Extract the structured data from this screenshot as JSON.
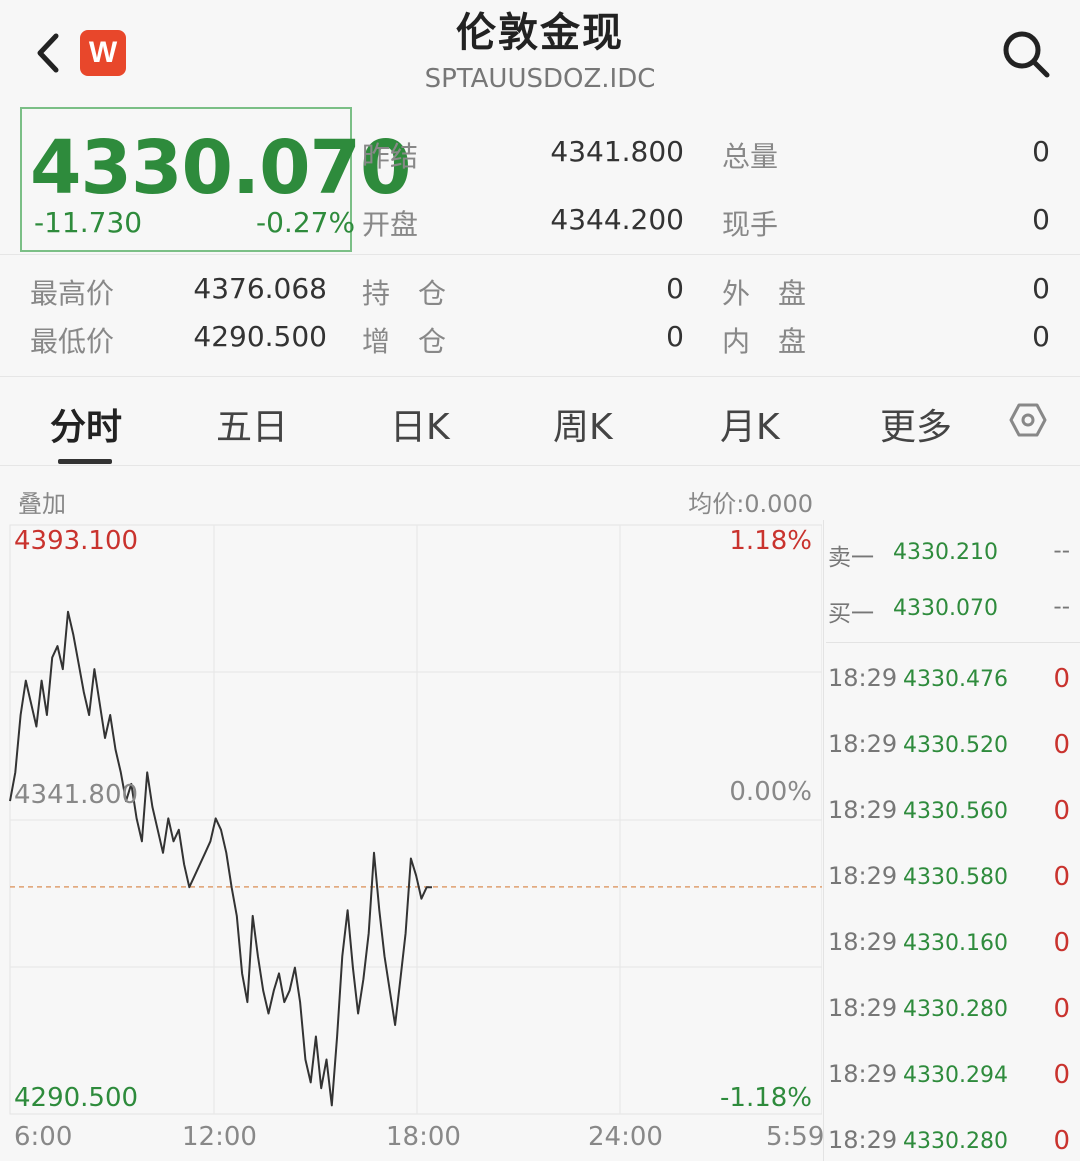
{
  "header": {
    "title": "伦敦金现",
    "code": "SPTAUUSDOZ.IDC",
    "logo": "W"
  },
  "quote": {
    "price": "4330.070",
    "change": "-11.730",
    "change_pct": "-0.27%",
    "prev_close_label": "昨结",
    "prev_close": "4341.800",
    "open_label": "开盘",
    "open": "4344.200",
    "volume_label": "总量",
    "volume": "0",
    "current_hand_label": "现手",
    "current_hand": "0",
    "high_label": "最高价",
    "high": "4376.068",
    "low_label": "最低价",
    "low": "4290.500",
    "position_label": "持　仓",
    "position": "0",
    "add_position_label": "增　仓",
    "add_position": "0",
    "outer_label": "外　盘",
    "outer": "0",
    "inner_label": "内　盘",
    "inner": "0"
  },
  "tabs": [
    {
      "label": "分时"
    },
    {
      "label": "五日"
    },
    {
      "label": "日K"
    },
    {
      "label": "周K"
    },
    {
      "label": "月K"
    },
    {
      "label": "更多"
    }
  ],
  "chart_header": {
    "overlay": "叠加",
    "avg_price": "均价:0.000"
  },
  "chart_data": {
    "type": "line",
    "y_top": "4393.100",
    "y_mid": "4341.800",
    "y_bottom": "4290.500",
    "pct_top": "1.18%",
    "pct_mid": "0.00%",
    "pct_bottom": "-1.18%",
    "x_ticks": [
      "6:00",
      "12:00",
      "18:00",
      "24:00",
      "5:59"
    ],
    "ylim": [
      4290.5,
      4393.1
    ],
    "prev_close": 4341.8,
    "current_price": 4330.07,
    "series": [
      {
        "values": [
          4345,
          4350,
          4360,
          4366,
          4362,
          4358,
          4366,
          4360,
          4370,
          4372,
          4368,
          4378,
          4374,
          4369,
          4364,
          4360,
          4368,
          4362,
          4356,
          4360,
          4354,
          4350,
          4345,
          4348,
          4342,
          4338,
          4350,
          4344,
          4340,
          4336,
          4342,
          4338,
          4340,
          4334,
          4330,
          4332,
          4334,
          4336,
          4338,
          4342,
          4340,
          4336,
          4330,
          4325,
          4315,
          4310,
          4325,
          4318,
          4312,
          4308,
          4312,
          4315,
          4310,
          4312,
          4316,
          4310,
          4300,
          4296,
          4304,
          4295,
          4300,
          4292,
          4304,
          4318,
          4326,
          4316,
          4308,
          4314,
          4322,
          4336,
          4326,
          4318,
          4312,
          4306,
          4314,
          4322,
          4335,
          4332,
          4328,
          4330,
          4330
        ]
      }
    ]
  },
  "order_book": {
    "sell1_label": "卖一",
    "sell1_price": "4330.210",
    "sell1_vol": "--",
    "buy1_label": "买一",
    "buy1_price": "4330.070",
    "buy1_vol": "--"
  },
  "ticks": [
    {
      "time": "18:29",
      "price": "4330.476",
      "vol": "0"
    },
    {
      "time": "18:29",
      "price": "4330.520",
      "vol": "0"
    },
    {
      "time": "18:29",
      "price": "4330.560",
      "vol": "0"
    },
    {
      "time": "18:29",
      "price": "4330.580",
      "vol": "0"
    },
    {
      "time": "18:29",
      "price": "4330.160",
      "vol": "0"
    },
    {
      "time": "18:29",
      "price": "4330.280",
      "vol": "0"
    },
    {
      "time": "18:29",
      "price": "4330.294",
      "vol": "0"
    },
    {
      "time": "18:29",
      "price": "4330.280",
      "vol": "0"
    }
  ]
}
